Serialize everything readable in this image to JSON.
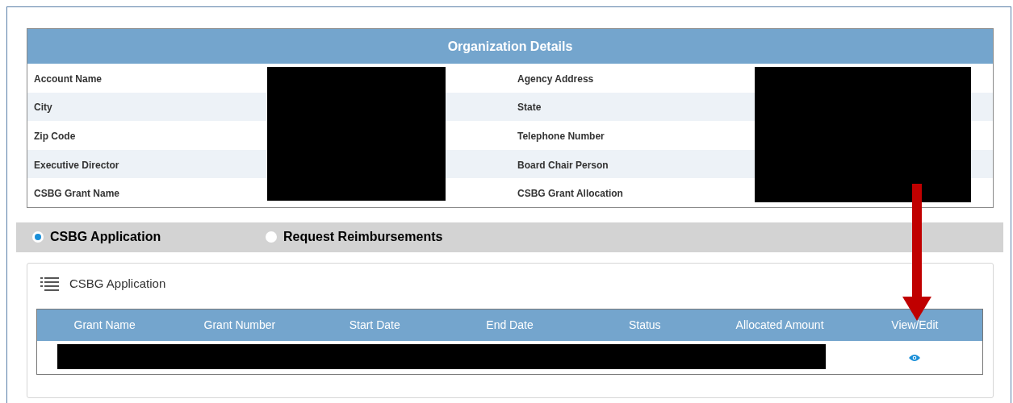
{
  "org_details": {
    "title": "Organization Details",
    "redacted": true,
    "rows": [
      {
        "label": "Account Name",
        "label_2": "Agency Address"
      },
      {
        "label": "City",
        "label_2": "State"
      },
      {
        "label": "Zip Code",
        "label_2": "Telephone Number"
      },
      {
        "label": "Executive Director",
        "label_2": "Board Chair Person"
      },
      {
        "label": "CSBG Grant Name",
        "label_2": "CSBG Grant Allocation"
      }
    ]
  },
  "options": [
    {
      "label": "CSBG Application",
      "selected": true
    },
    {
      "label": "Request Reimbursements",
      "selected": false
    }
  ],
  "panel": {
    "title": "CSBG Application",
    "table": {
      "columns": [
        "Grant Name",
        "Grant Number",
        "Start Date",
        "End Date",
        "Status",
        "Allocated Amount",
        "View/Edit"
      ],
      "rows": [
        {
          "redacted": true
        }
      ]
    }
  }
}
